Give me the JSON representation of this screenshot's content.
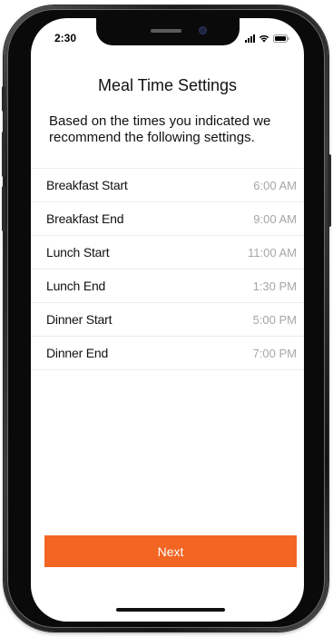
{
  "status_bar": {
    "time": "2:30",
    "icons": [
      "signal-icon",
      "wifi-icon",
      "battery-icon"
    ]
  },
  "page": {
    "title": "Meal Time Settings",
    "intro": "Based on the times you indicated we recommend the following settings."
  },
  "settings": [
    {
      "label": "Breakfast Start",
      "value": "6:00 AM"
    },
    {
      "label": "Breakfast End",
      "value": "9:00 AM"
    },
    {
      "label": "Lunch Start",
      "value": "11:00 AM"
    },
    {
      "label": "Lunch End",
      "value": "1:30 PM"
    },
    {
      "label": "Dinner Start",
      "value": "5:00 PM"
    },
    {
      "label": "Dinner End",
      "value": "7:00 PM"
    }
  ],
  "next_button": {
    "label": "Next"
  },
  "colors": {
    "accent": "#f26522",
    "value_text": "#a6a6a6",
    "divider": "#ececec"
  }
}
